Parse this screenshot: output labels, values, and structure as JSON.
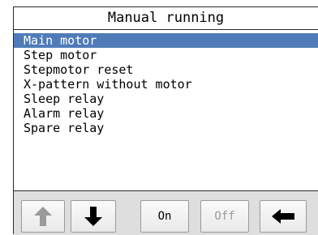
{
  "title": "Manual running",
  "menu": {
    "items": [
      {
        "label": "Main motor",
        "selected": true
      },
      {
        "label": "Step motor",
        "selected": false
      },
      {
        "label": "Stepmotor reset",
        "selected": false
      },
      {
        "label": "X-pattern without motor",
        "selected": false
      },
      {
        "label": "Sleep relay",
        "selected": false
      },
      {
        "label": "Alarm relay",
        "selected": false
      },
      {
        "label": "Spare relay",
        "selected": false
      }
    ]
  },
  "toolbar": {
    "up": {
      "icon": "arrow-up-icon",
      "enabled": false
    },
    "down": {
      "icon": "arrow-down-icon",
      "enabled": true
    },
    "on_label": "On",
    "off_label": "Off",
    "back": {
      "icon": "arrow-left-icon",
      "enabled": true
    }
  },
  "colors": {
    "selection": "#4f7bb8",
    "toolbar_bg": "#dedede",
    "disabled": "#9a9a9a"
  }
}
